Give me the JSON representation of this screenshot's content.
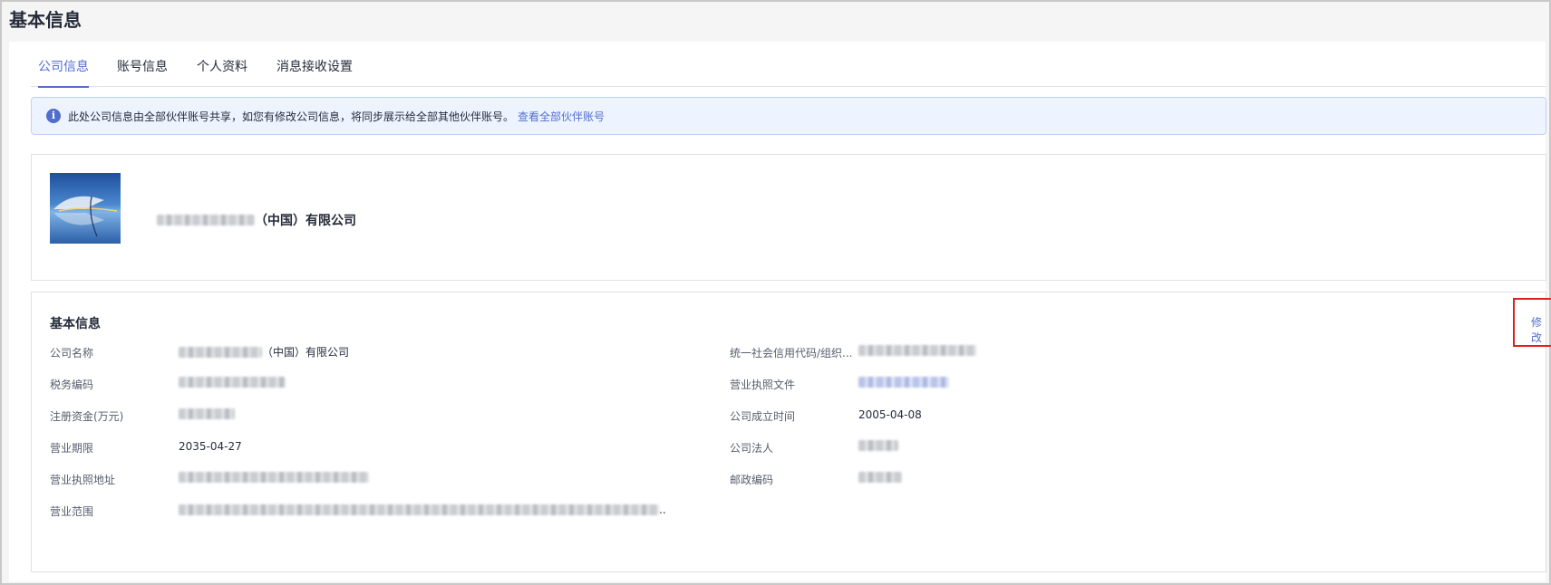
{
  "page": {
    "title": "基本信息"
  },
  "tabs": [
    {
      "label": "公司信息",
      "active": true
    },
    {
      "label": "账号信息",
      "active": false
    },
    {
      "label": "个人资料",
      "active": false
    },
    {
      "label": "消息接收设置",
      "active": false
    }
  ],
  "notice": {
    "icon": "info-icon",
    "text": "此处公司信息由全部伙伴账号共享，如您有修改公司信息，将同步展示给全部其他伙伴账号。",
    "link": "查看全部伙伴账号"
  },
  "company": {
    "name_suffix": "（中国）有限公司",
    "logo": "company-logo-image"
  },
  "basic_info": {
    "title": "基本信息",
    "edit_label": "修改",
    "fields": {
      "company_name": {
        "label": "公司名称",
        "value_suffix": "（中国）有限公司"
      },
      "tax_code": {
        "label": "税务编码"
      },
      "registered_capital": {
        "label": "注册资金(万元)"
      },
      "business_term": {
        "label": "营业期限",
        "value": "2035-04-27"
      },
      "license_address": {
        "label": "营业执照地址"
      },
      "business_scope": {
        "label": "营业范围",
        "value_suffix": ".."
      },
      "credit_code": {
        "label": "统一社会信用代码/组织..."
      },
      "license_file": {
        "label": "营业执照文件"
      },
      "established_date": {
        "label": "公司成立时间",
        "value": "2005-04-08"
      },
      "legal_person": {
        "label": "公司法人"
      },
      "postal_code": {
        "label": "邮政编码"
      }
    }
  },
  "colors": {
    "accent": "#526ecc",
    "notice_bg": "#eef4ff",
    "highlight_border": "#e02020"
  }
}
